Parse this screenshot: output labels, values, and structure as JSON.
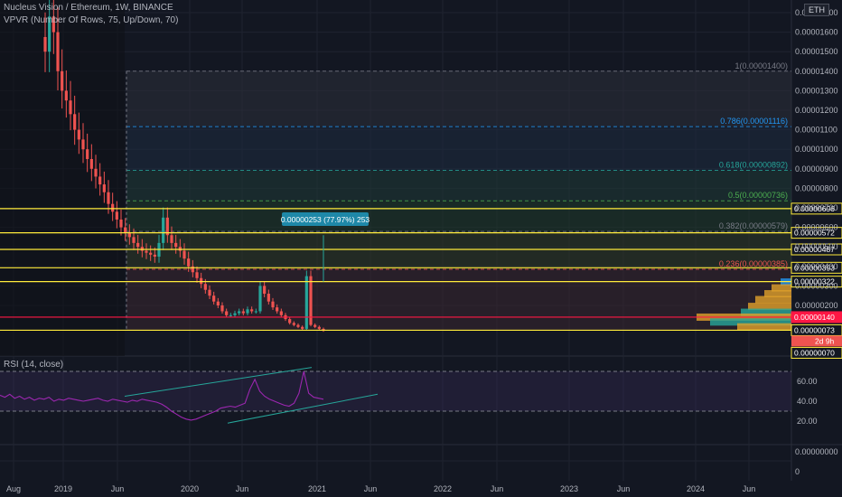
{
  "header": {
    "symbol_line": "Nucleus Vision / Ethereum, 1W, BINANCE",
    "indicator_line": "VPVR (Number Of Rows, 75, Up/Down, 70)",
    "rsi_line": "RSI (14, close)",
    "currency_badge": "ETH"
  },
  "chart_data": {
    "type": "candlestick",
    "title": "Nucleus Vision / Ethereum, 1W, BINANCE",
    "x_tick_labels": [
      "Aug",
      "2019",
      "Jun",
      "2020",
      "Jun",
      "2021",
      "Jun",
      "2022",
      "Jun",
      "2023",
      "Jun",
      "2024",
      "Jun"
    ],
    "y_tick_labels": [
      "0.00001700",
      "0.00001600",
      "0.00001500",
      "0.00001400",
      "0.00001300",
      "0.00001200",
      "0.00001100",
      "0.00001000",
      "0.00000900",
      "0.00000800",
      "0.00000700",
      "0.00000600",
      "0.00000500",
      "0.00000400",
      "0.00000300",
      "0.00000200"
    ],
    "price_series_close_approx": [
      1.5e-05,
      1.68e-05,
      1.6e-05,
      1.4e-05,
      1.3e-05,
      1.25e-05,
      1.18e-05,
      1.1e-05,
      1.05e-05,
      1e-05,
      9.5e-06,
      9e-06,
      8.6e-06,
      8.2e-06,
      7.8e-06,
      7.2e-06,
      6.8e-06,
      6.4e-06,
      6e-06,
      5.7e-06,
      5.5e-06,
      5.2e-06,
      5e-06,
      4.8e-06,
      4.7e-06,
      4.6e-06,
      4.5e-06,
      5.2e-06,
      6.5e-06,
      5.6e-06,
      5.2e-06,
      5e-06,
      4.8e-06,
      4.4e-06,
      4e-06,
      3.7e-06,
      3.4e-06,
      3.1e-06,
      2.8e-06,
      2.5e-06,
      2.2e-06,
      2e-06,
      1.7e-06,
      1.5e-06,
      1.5e-06,
      1.6e-06,
      1.7e-06,
      1.6e-06,
      1.8e-06,
      1.7e-06,
      1.7e-06,
      3e-06,
      2.6e-06,
      2.2e-06,
      1.9e-06,
      1.7e-06,
      1.5e-06,
      1.3e-06,
      1.1e-06,
      1e-06,
      9e-07,
      8e-07,
      3.5e-06,
      1e-06,
      9e-07,
      8e-07,
      7e-07
    ],
    "fib_levels": [
      {
        "label": "1(0.00001400)",
        "value": 1.4e-05,
        "color": "#787b86"
      },
      {
        "label": "0.786(0.00001116)",
        "value": 1.116e-05,
        "color": "#2196f3"
      },
      {
        "label": "0.618(0.00000892)",
        "value": 8.92e-06,
        "color": "#26a69a"
      },
      {
        "label": "0.5(0.00000736)",
        "value": 7.36e-06,
        "color": "#4caf50"
      },
      {
        "label": "0.382(0.00000579)",
        "value": 5.79e-06,
        "color": "#787b86"
      },
      {
        "label": "0.236(0.00000385)",
        "value": 3.85e-06,
        "color": "#ef5350"
      }
    ],
    "horizontal_levels": [
      {
        "label": "0.00000696",
        "value": 6.96e-06,
        "color": "#ffeb3b"
      },
      {
        "label": "0.00000572",
        "value": 5.72e-06,
        "color": "#ffeb3b"
      },
      {
        "label": "0.00000487",
        "value": 4.87e-06,
        "color": "#ffeb3b"
      },
      {
        "label": "0.00000393",
        "value": 3.93e-06,
        "color": "#ffeb3b"
      },
      {
        "label": "0.00000322",
        "value": 3.22e-06,
        "color": "#ffeb3b"
      },
      {
        "label": "0.00000140",
        "value": 1.4e-06,
        "color": "#ff1744"
      },
      {
        "label": "0.00000073",
        "value": 7.3e-07,
        "color": "#ffeb3b"
      }
    ],
    "measure_label": "0.00000253 (77.97%) 253",
    "last_price_label": "0.00000073",
    "countdown_label": "2d 9h",
    "bottom_price_label": "0.00000070",
    "rsi": {
      "length": 14,
      "source": "close",
      "y_tick_labels": [
        "60.00",
        "40.00",
        "20.00"
      ],
      "upper_band": 70,
      "lower_band": 30,
      "values_approx": [
        46,
        44,
        47,
        43,
        45,
        42,
        44,
        41,
        43,
        42,
        44,
        40,
        42,
        41,
        43,
        42,
        41,
        40,
        41,
        42,
        43,
        41,
        40,
        42,
        41,
        40,
        39,
        41,
        40,
        42,
        41,
        40,
        39,
        37,
        34,
        30,
        27,
        24,
        22,
        21,
        22,
        24,
        26,
        28,
        30,
        33,
        34,
        35,
        34,
        36,
        38,
        52,
        62,
        50,
        45,
        42,
        40,
        38,
        36,
        35,
        38,
        48,
        70,
        48,
        44,
        43,
        42
      ],
      "trendline_upper": "rising",
      "trendline_lower": "rising"
    },
    "extra_pane_ticks": [
      "0.00000000",
      "0"
    ]
  }
}
